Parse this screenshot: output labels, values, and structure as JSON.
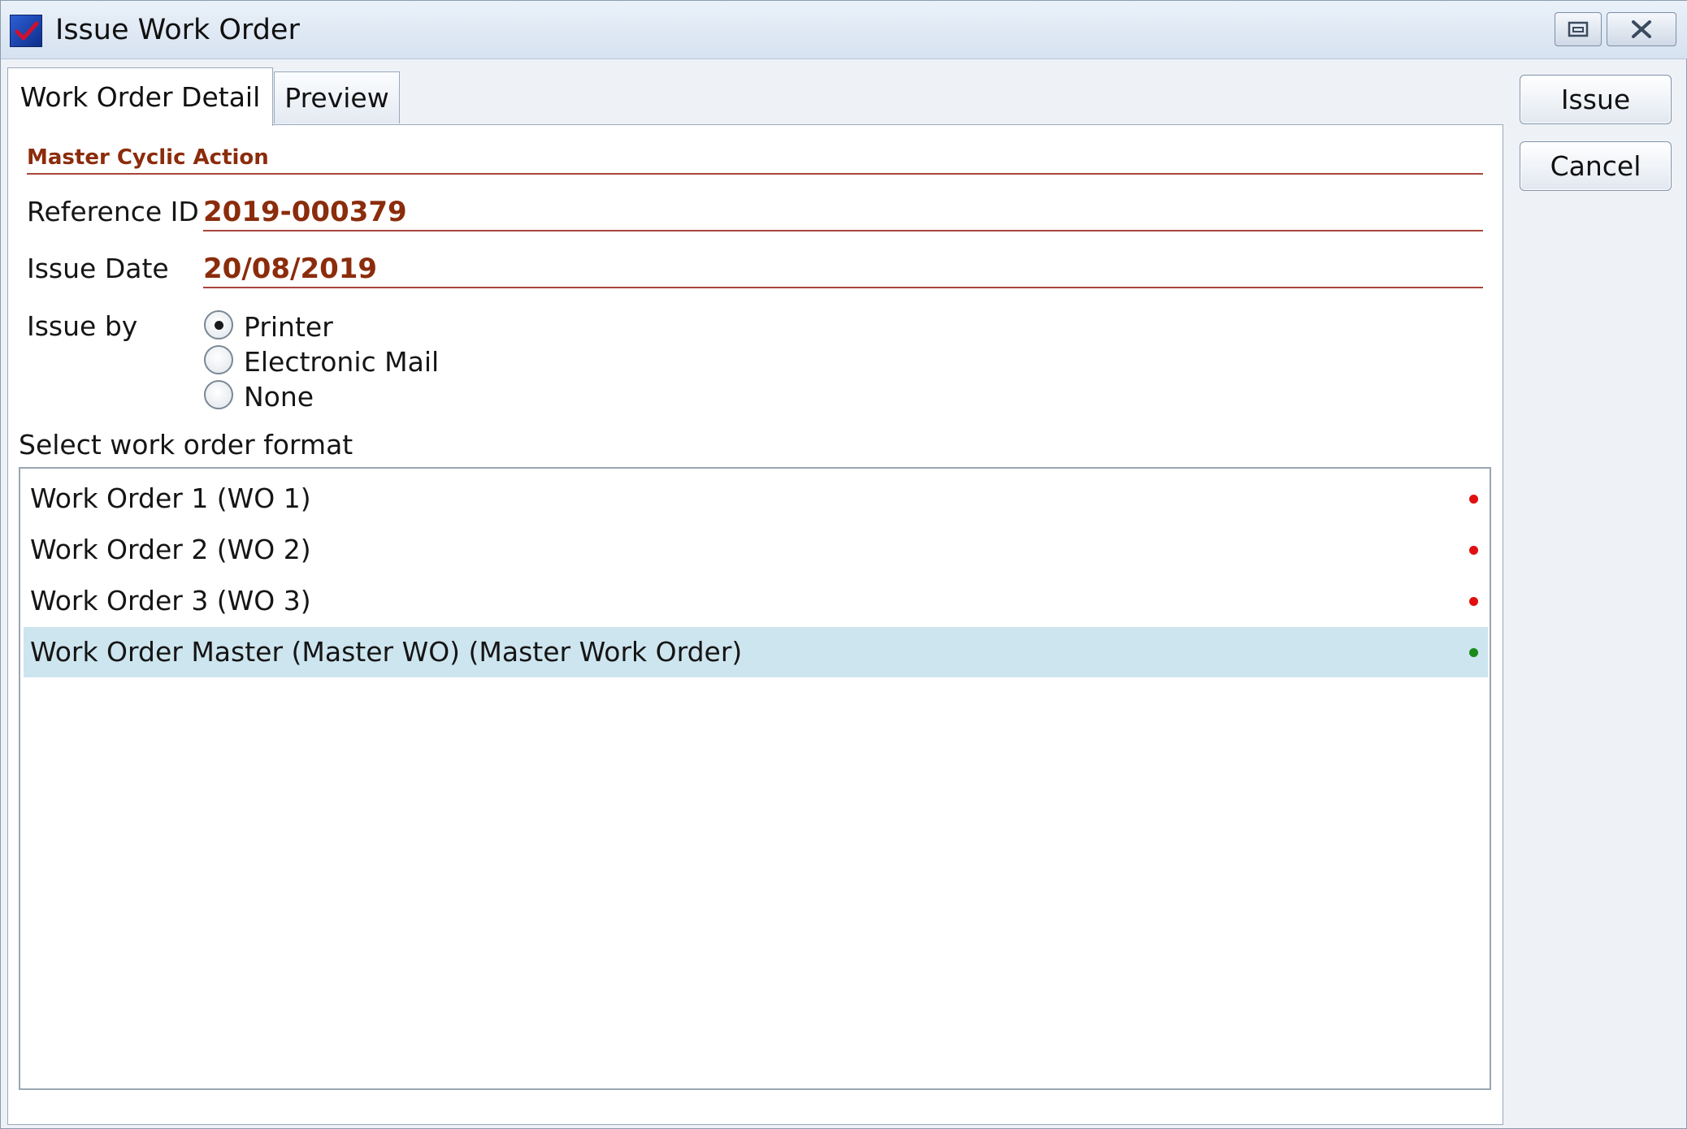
{
  "window": {
    "title": "Issue Work Order",
    "restore_icon": "restore-icon",
    "close_icon": "close-icon"
  },
  "tabs": [
    {
      "label": "Work Order Detail",
      "active": true
    },
    {
      "label": "Preview",
      "active": false
    }
  ],
  "actions": {
    "issue_label": "Issue",
    "cancel_label": "Cancel"
  },
  "form": {
    "section_title": "Master Cyclic Action",
    "reference_id_label": "Reference ID",
    "reference_id_value": "2019-000379",
    "issue_date_label": "Issue Date",
    "issue_date_value": "20/08/2019",
    "issue_by_label": "Issue by",
    "issue_by_options": [
      {
        "label": "Printer",
        "selected": true
      },
      {
        "label": "Electronic Mail",
        "selected": false
      },
      {
        "label": "None",
        "selected": false
      }
    ]
  },
  "format_list": {
    "label": "Select work order format",
    "items": [
      {
        "label": "Work Order 1 (WO 1)",
        "status_color": "#e01010",
        "selected": false
      },
      {
        "label": "Work Order 2 (WO 2)",
        "status_color": "#e01010",
        "selected": false
      },
      {
        "label": "Work Order 3 (WO 3)",
        "status_color": "#e01010",
        "selected": false
      },
      {
        "label": "Work Order Master (Master WO) (Master Work Order)",
        "status_color": "#1a8a1a",
        "selected": true
      }
    ]
  },
  "colors": {
    "accent": "#8b2c0c",
    "selection": "#cde5ef"
  }
}
